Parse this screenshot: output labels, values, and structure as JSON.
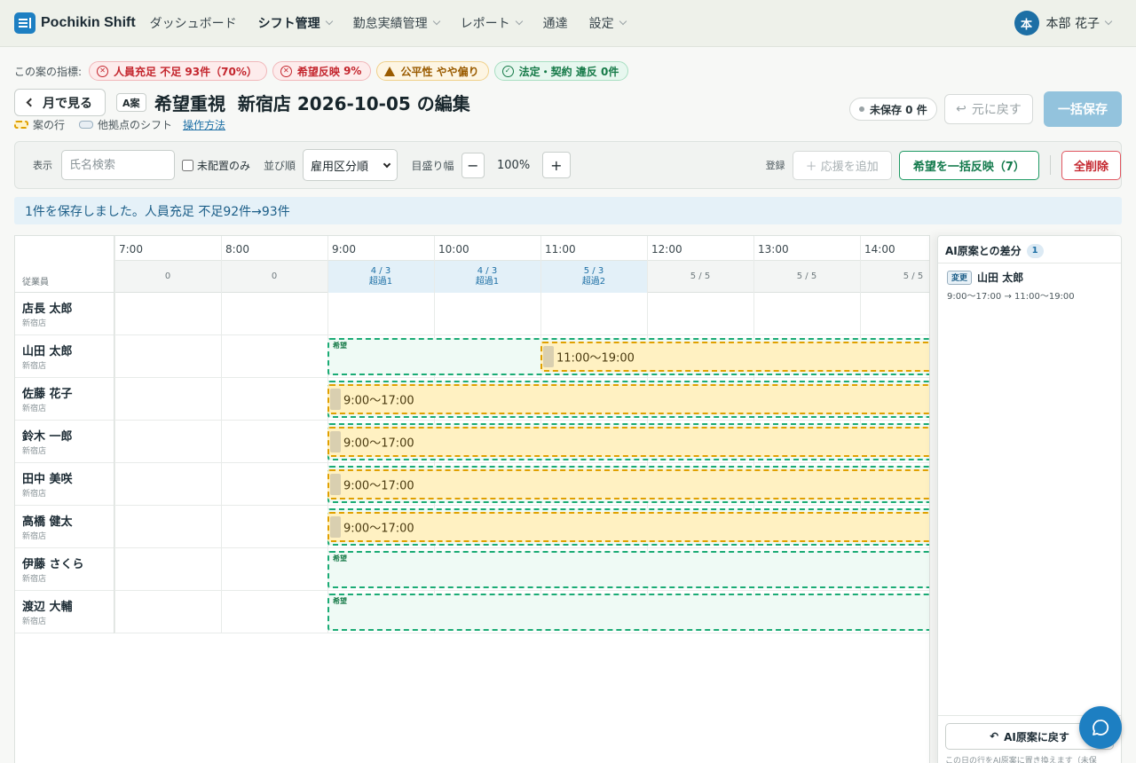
{
  "app": {
    "name": "Pochikin Shift"
  },
  "nav": [
    {
      "label": "ダッシュボード",
      "dropdown": false,
      "active": false
    },
    {
      "label": "シフト管理",
      "dropdown": true,
      "active": true
    },
    {
      "label": "勤怠実績管理",
      "dropdown": true,
      "active": false
    },
    {
      "label": "レポート",
      "dropdown": true,
      "active": false
    },
    {
      "label": "通達",
      "dropdown": false,
      "active": false
    },
    {
      "label": "設定",
      "dropdown": true,
      "active": false
    }
  ],
  "user": {
    "initial": "本",
    "name": "本部 花子"
  },
  "metrics": {
    "label": "この案の指標:",
    "staffing": {
      "name": "人員充足",
      "value": "不足 93件（70%）"
    },
    "wishes": {
      "name": "希望反映",
      "value": "9%"
    },
    "fairness": {
      "name": "公平性",
      "value": "やや偏り"
    },
    "legal": {
      "name": "法定・契約",
      "value": "違反 0件"
    }
  },
  "header": {
    "back_label": "月で見る",
    "plan_tag": "A案",
    "title": "希望重視  新宿店 2026-10-05 の編集",
    "legend_own": "案の行",
    "legend_other": "他拠点のシフト",
    "help_link": "操作方法",
    "unsaved": "未保存 0 件",
    "undo": "元に戻す",
    "save": "一括保存"
  },
  "toolbar": {
    "display_label": "表示",
    "search_placeholder": "氏名検索",
    "unassigned_label": "未配置のみ",
    "sort_label": "並び順",
    "sort_value": "雇用区分順",
    "scale_label": "目盛り幅",
    "zoom": "100%",
    "minus": "−",
    "plus": "+",
    "register_label": "登録",
    "add_support": "＋ 応援を追加",
    "apply_wishes": "希望を一括反映（7）",
    "delete_all": "全削除"
  },
  "toast": "1件を保存しました。人員充足 不足92件→93件",
  "grid": {
    "employee_header": "従業員",
    "times": [
      "7:00",
      "8:00",
      "9:00",
      "10:00",
      "11:00",
      "12:00",
      "13:00",
      "14:00"
    ],
    "counts": [
      {
        "ratio": "0",
        "note": "",
        "over": false
      },
      {
        "ratio": "0",
        "note": "",
        "over": false
      },
      {
        "ratio": "4 / 3",
        "note": "超過1",
        "over": true
      },
      {
        "ratio": "4 / 3",
        "note": "超過1",
        "over": true
      },
      {
        "ratio": "5 / 3",
        "note": "超過2",
        "over": true
      },
      {
        "ratio": "5 / 5",
        "note": "",
        "over": false
      },
      {
        "ratio": "5 / 5",
        "note": "",
        "over": false
      },
      {
        "ratio": "5 / 5",
        "note": "",
        "over": false
      }
    ],
    "employees": [
      {
        "name": "店長 太郎",
        "store": "新宿店",
        "wish": null,
        "shift": null
      },
      {
        "name": "山田 太郎",
        "store": "新宿店",
        "wish": {
          "label": "希望",
          "start": 9,
          "end": 17
        },
        "shift": {
          "label": "11:00〜19:00",
          "start": 11,
          "end": 19
        }
      },
      {
        "name": "佐藤 花子",
        "store": "新宿店",
        "wish": {
          "label": "",
          "start": 9,
          "end": 17
        },
        "shift": {
          "label": "9:00〜17:00",
          "start": 9,
          "end": 17
        }
      },
      {
        "name": "鈴木 一郎",
        "store": "新宿店",
        "wish": {
          "label": "",
          "start": 9,
          "end": 17
        },
        "shift": {
          "label": "9:00〜17:00",
          "start": 9,
          "end": 17
        }
      },
      {
        "name": "田中 美咲",
        "store": "新宿店",
        "wish": {
          "label": "",
          "start": 9,
          "end": 17
        },
        "shift": {
          "label": "9:00〜17:00",
          "start": 9,
          "end": 17
        }
      },
      {
        "name": "高橋 健太",
        "store": "新宿店",
        "wish": {
          "label": "",
          "start": 9,
          "end": 17
        },
        "shift": {
          "label": "9:00〜17:00",
          "start": 9,
          "end": 17
        }
      },
      {
        "name": "伊藤 さくら",
        "store": "新宿店",
        "wish": {
          "label": "希望",
          "start": 9,
          "end": 17
        },
        "shift": null
      },
      {
        "name": "渡辺 大輔",
        "store": "新宿店",
        "wish": {
          "label": "希望",
          "start": 9,
          "end": 17
        },
        "shift": null
      }
    ]
  },
  "panel": {
    "title": "AI原案との差分",
    "count": "1",
    "diff": {
      "tag": "変更",
      "name": "山田 太郎",
      "detail": "9:00〜17:00 → 11:00〜19:00"
    },
    "revert_button": "AI原案に戻す",
    "revert_note": "この日の行をAI原案に置き換えます（未保"
  }
}
